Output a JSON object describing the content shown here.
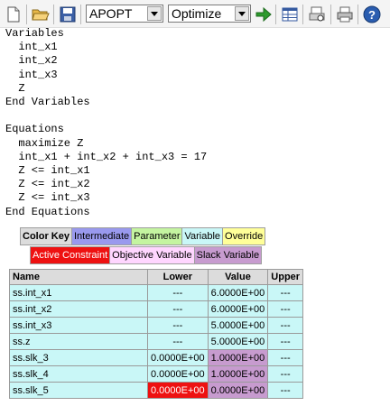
{
  "toolbar": {
    "solver_select": "APOPT",
    "mode_select": "Optimize",
    "buttons": [
      "new-file-icon",
      "open-folder-icon",
      "save-icon",
      "run-arrow-icon",
      "grid-icon",
      "print-preview-icon",
      "print-icon",
      "help-icon"
    ]
  },
  "model_text": "Variables\n  int_x1\n  int_x2\n  int_x3\n  Z\nEnd Variables\n\nEquations\n  maximize Z\n  int_x1 + int_x2 + int_x3 = 17\n  Z <= int_x1\n  Z <= int_x2\n  Z <= int_x3\nEnd Equations",
  "legend": {
    "row1": [
      {
        "label": "Color Key",
        "color": "#dcdcdc",
        "bold": true
      },
      {
        "label": "Intermediate",
        "color": "#9999ee"
      },
      {
        "label": "Parameter",
        "color": "#c4f4a0"
      },
      {
        "label": "Variable",
        "color": "#c9f7f7"
      },
      {
        "label": "Override",
        "color": "#ffff99"
      }
    ],
    "row2": [
      {
        "label": "Active Constraint",
        "color": "#ee1111",
        "text_color": "#ffffff"
      },
      {
        "label": "Objective Variable",
        "color": "#ffd6ff"
      },
      {
        "label": "Slack Variable",
        "color": "#c79bcf"
      }
    ]
  },
  "table": {
    "headers": {
      "name": "Name",
      "lower": "Lower",
      "value": "Value",
      "upper": "Upper"
    },
    "rows": [
      {
        "name": "ss.int_x1",
        "lower": "---",
        "value": "6.0000E+00",
        "upper": "---",
        "name_bg": "#c9f7f7",
        "lower_bg": "#c9f7f7",
        "value_bg": "#c9f7f7",
        "upper_bg": "#c9f7f7"
      },
      {
        "name": "ss.int_x2",
        "lower": "---",
        "value": "6.0000E+00",
        "upper": "---",
        "name_bg": "#c9f7f7",
        "lower_bg": "#c9f7f7",
        "value_bg": "#c9f7f7",
        "upper_bg": "#c9f7f7"
      },
      {
        "name": "ss.int_x3",
        "lower": "---",
        "value": "5.0000E+00",
        "upper": "---",
        "name_bg": "#c9f7f7",
        "lower_bg": "#c9f7f7",
        "value_bg": "#c9f7f7",
        "upper_bg": "#c9f7f7"
      },
      {
        "name": "ss.z",
        "lower": "---",
        "value": "5.0000E+00",
        "upper": "---",
        "name_bg": "#c9f7f7",
        "lower_bg": "#c9f7f7",
        "value_bg": "#c9f7f7",
        "upper_bg": "#c9f7f7"
      },
      {
        "name": "ss.slk_3",
        "lower": "0.0000E+00",
        "value": "1.0000E+00",
        "upper": "---",
        "name_bg": "#c9f7f7",
        "lower_bg": "#c9f7f7",
        "value_bg": "#c79bcf",
        "upper_bg": "#c9f7f7"
      },
      {
        "name": "ss.slk_4",
        "lower": "0.0000E+00",
        "value": "1.0000E+00",
        "upper": "---",
        "name_bg": "#c9f7f7",
        "lower_bg": "#c9f7f7",
        "value_bg": "#c79bcf",
        "upper_bg": "#c9f7f7"
      },
      {
        "name": "ss.slk_5",
        "lower": "0.0000E+00",
        "value": "0.0000E+00",
        "upper": "---",
        "name_bg": "#c9f7f7",
        "lower_bg": "#ee1111",
        "value_bg": "#c79bcf",
        "upper_bg": "#c9f7f7",
        "lower_fg": "#ffffff"
      }
    ]
  }
}
